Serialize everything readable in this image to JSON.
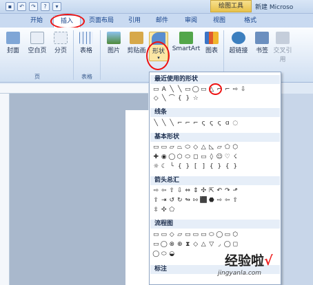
{
  "qat": {
    "icons": [
      "save-icon",
      "undo-icon",
      "redo-icon",
      "help-icon",
      "dropdown-icon"
    ]
  },
  "context_tab": "绘图工具",
  "window_title": "新建 Microso",
  "tabs": [
    {
      "label": "开始"
    },
    {
      "label": "插入"
    },
    {
      "label": "页面布局"
    },
    {
      "label": "引用"
    },
    {
      "label": "邮件"
    },
    {
      "label": "审阅"
    },
    {
      "label": "视图"
    },
    {
      "label": "格式"
    }
  ],
  "ribbon": {
    "buttons": [
      {
        "label": "封面"
      },
      {
        "label": "空白页"
      },
      {
        "label": "分页"
      },
      {
        "label": "表格"
      },
      {
        "label": "图片"
      },
      {
        "label": "剪贴画"
      },
      {
        "label": "形状"
      },
      {
        "label": "SmartArt"
      },
      {
        "label": "图表"
      },
      {
        "label": "超链接"
      },
      {
        "label": "书签"
      },
      {
        "label": "交叉引用"
      }
    ],
    "groups": [
      "页",
      "表格"
    ]
  },
  "gallery": {
    "categories": [
      {
        "label": "最近使用的形状"
      },
      {
        "label": "线条"
      },
      {
        "label": "基本形状"
      },
      {
        "label": "箭头总汇"
      },
      {
        "label": "流程图"
      },
      {
        "label": "标注"
      }
    ],
    "rows": [
      [
        "▭",
        "A",
        "╲",
        "╲",
        "▭",
        "◯",
        "▭",
        "△",
        "⌐",
        "⌐",
        "⇨",
        "⇩"
      ],
      [
        "◇",
        "╲",
        "⌒",
        "{",
        "}",
        "☆"
      ],
      [
        "╲",
        "╲",
        "╲",
        "⌐",
        "⌐",
        "⌐",
        "ς",
        "ς",
        "ς",
        "ɑ",
        "◌"
      ],
      [
        "▭",
        "▭",
        "▱",
        "⏢",
        "⬭",
        "◇",
        "△",
        "◺",
        "▱",
        "⬠",
        "⬡"
      ],
      [
        "✚",
        "◉",
        "◯",
        "⬡",
        "⬭",
        "◻",
        "▭",
        "◊",
        "☺",
        "♡",
        "☇"
      ],
      [
        "☼",
        "☾",
        "╰",
        "{",
        "}",
        "[",
        "]",
        "{",
        "}",
        "{",
        "}"
      ],
      [
        "⇨",
        "⇦",
        "⇧",
        "⇩",
        "⇔",
        "⇕",
        "✣",
        "⇱",
        "↶",
        "↷",
        "⬏"
      ],
      [
        "⇪",
        "⇥",
        "↺",
        "↻",
        "↬",
        "⇰",
        "⬛",
        "⬣",
        "⇨",
        "⇦",
        "⇧"
      ],
      [
        "⇳",
        "✣",
        "⬠"
      ],
      [
        "▭",
        "▭",
        "◇",
        "▱",
        "▭",
        "▭",
        "▭",
        "⬭",
        "◯",
        "▭",
        "⬡"
      ],
      [
        "▭",
        "◯",
        "⊗",
        "⊕",
        "⧗",
        "◇",
        "△",
        "▽",
        "◞",
        "◯",
        "◻"
      ],
      [
        "◯",
        "⬭",
        "◒"
      ]
    ]
  },
  "watermark": {
    "text": "经验啦",
    "check": "√",
    "url": "jingyanla.com"
  }
}
